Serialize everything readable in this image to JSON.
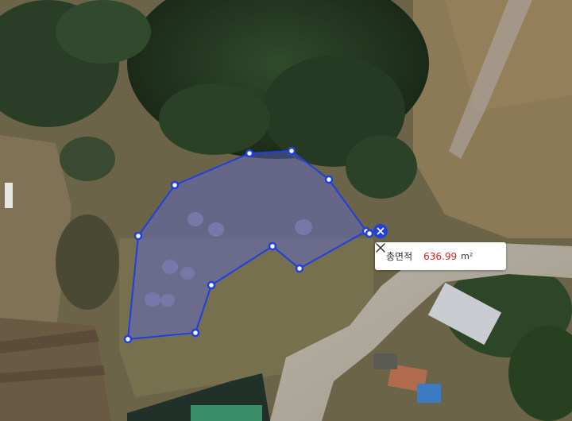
{
  "map": {
    "type": "aerial-satellite",
    "polygon_vertex_count": 12,
    "colors": {
      "outline": "#1f3fe0",
      "fill": "rgba(95,105,215,0.45)",
      "vertex_fill": "#ffffff",
      "value_text": "#e02020"
    }
  },
  "measurement": {
    "label": "총면적",
    "value": "636.99",
    "unit": "m²"
  },
  "icons": {
    "close": "close-icon",
    "delete_shape": "delete-shape-icon"
  }
}
